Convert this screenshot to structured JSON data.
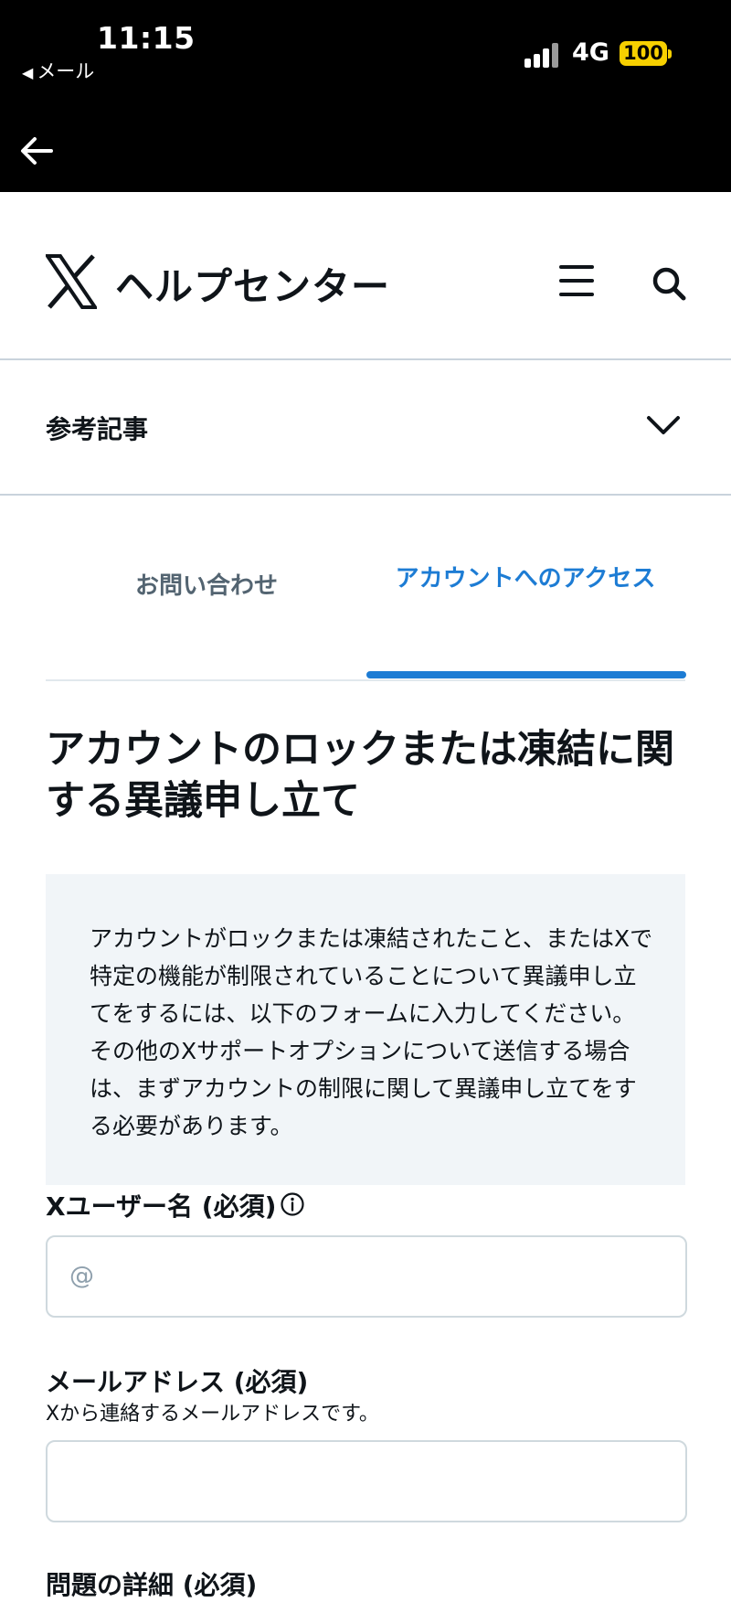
{
  "status_bar": {
    "time": "11:15",
    "back_app": "メール",
    "network": "4G",
    "battery": "100"
  },
  "header": {
    "brand": "ヘルプセンター",
    "logo_icon": "x-logo-icon",
    "menu_icon": "hamburger-menu-icon",
    "search_icon": "search-icon"
  },
  "related": {
    "label": "参考記事"
  },
  "tabs": [
    {
      "label": "お問い合わせ",
      "active": false
    },
    {
      "label": "アカウントへのアクセス",
      "active": true
    }
  ],
  "page": {
    "title": "アカウントのロックまたは凍結に関する異議申し立て",
    "info_text": "アカウントがロックまたは凍結されたこと、またはXで特定の機能が制限されていることについて異議申し立てをするには、以下のフォームに入力してください。その他のXサポートオプションについて送信する場合は、まずアカウントの制限に関して異議申し立てをする必要があります。"
  },
  "form": {
    "username": {
      "label": "Xユーザー名 (必須)",
      "value": "",
      "placeholder": "@"
    },
    "email": {
      "label": "メールアドレス (必須)",
      "help": "Xから連絡するメールアドレスです。",
      "value": ""
    },
    "details": {
      "label": "問題の詳細 (必須)"
    }
  },
  "colors": {
    "accent": "#1d7cd4",
    "battery": "#f7d000",
    "info_bg": "#f1f5f8"
  }
}
